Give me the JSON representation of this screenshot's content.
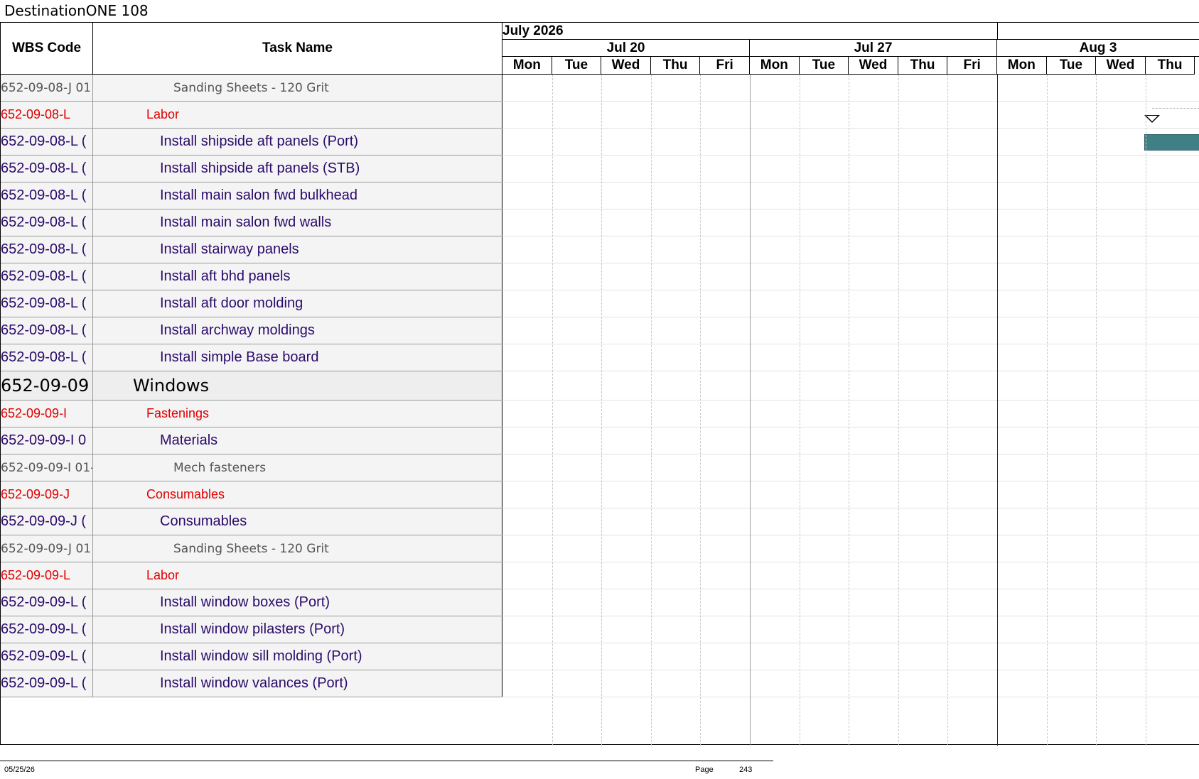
{
  "project_title": "DestinationONE 108",
  "columns": {
    "wbs_code": "WBS Code",
    "task_name": "Task Name"
  },
  "timeline": {
    "months": [
      "July 2026",
      ""
    ],
    "weeks": [
      "Jul 20",
      "Jul 27",
      "Aug 3"
    ],
    "days": [
      "Mon",
      "Tue",
      "Wed",
      "Thu",
      "Fri",
      "Mon",
      "Tue",
      "Wed",
      "Thu",
      "Fri",
      "Mon",
      "Tue",
      "Wed",
      "Thu"
    ]
  },
  "rows": [
    {
      "wbs": "652-09-08-J 01",
      "name": "Sanding Sheets - 120 Grit",
      "level": "res"
    },
    {
      "wbs": "652-09-08-L",
      "name": "Labor",
      "level": "cat"
    },
    {
      "wbs": "652-09-08-L (",
      "name": "Install shipside aft panels (Port)",
      "level": "task"
    },
    {
      "wbs": "652-09-08-L (",
      "name": "Install shipside aft panels (STB)",
      "level": "task"
    },
    {
      "wbs": "652-09-08-L (",
      "name": "Install main salon fwd bulkhead",
      "level": "task"
    },
    {
      "wbs": "652-09-08-L (",
      "name": "Install main salon fwd walls",
      "level": "task"
    },
    {
      "wbs": "652-09-08-L (",
      "name": "Install stairway panels",
      "level": "task"
    },
    {
      "wbs": "652-09-08-L (",
      "name": "Install aft bhd panels",
      "level": "task"
    },
    {
      "wbs": "652-09-08-L (",
      "name": "Install aft door molding",
      "level": "task"
    },
    {
      "wbs": "652-09-08-L (",
      "name": "Install archway moldings",
      "level": "task"
    },
    {
      "wbs": "652-09-08-L (",
      "name": "Install simple Base board",
      "level": "task"
    },
    {
      "wbs": "652-09-09",
      "name": "Windows",
      "level": "group"
    },
    {
      "wbs": "652-09-09-I",
      "name": "Fastenings",
      "level": "cat"
    },
    {
      "wbs": "652-09-09-I 0",
      "name": "Materials",
      "level": "task"
    },
    {
      "wbs": "652-09-09-I 01-",
      "name": "Mech fasteners",
      "level": "res"
    },
    {
      "wbs": "652-09-09-J",
      "name": "Consumables",
      "level": "cat"
    },
    {
      "wbs": "652-09-09-J (",
      "name": "Consumables",
      "level": "task"
    },
    {
      "wbs": "652-09-09-J 01",
      "name": "Sanding Sheets - 120 Grit",
      "level": "res"
    },
    {
      "wbs": "652-09-09-L",
      "name": "Labor",
      "level": "cat"
    },
    {
      "wbs": "652-09-09-L (",
      "name": "Install window boxes (Port)",
      "level": "task"
    },
    {
      "wbs": "652-09-09-L (",
      "name": "Install window pilasters (Port)",
      "level": "task"
    },
    {
      "wbs": "652-09-09-L (",
      "name": "Install window sill molding (Port)",
      "level": "task"
    },
    {
      "wbs": "652-09-09-L (",
      "name": "Install window valances (Port)",
      "level": "task"
    }
  ],
  "footer": {
    "date": "05/25/26",
    "page_label": "Page",
    "page_number": "243"
  },
  "colors": {
    "resource_text": "#555555",
    "category_text": "#e00000",
    "task_text": "#2a0a6b",
    "task_bar": "#3e8085",
    "today_line": "#1a1aa0"
  }
}
